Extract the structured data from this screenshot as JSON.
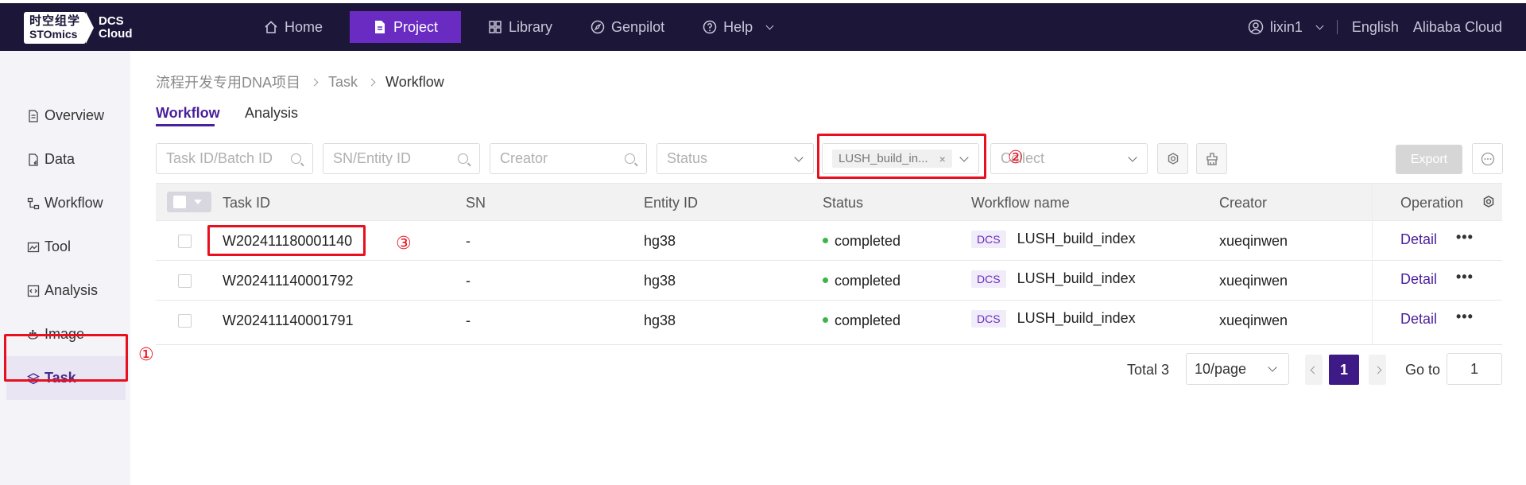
{
  "logo": {
    "cn": "时空组学",
    "en": "STOmics",
    "product_line1": "DCS",
    "product_line2": "Cloud"
  },
  "nav": [
    {
      "label": "Home",
      "icon": "home-icon"
    },
    {
      "label": "Project",
      "icon": "document-icon",
      "active": true
    },
    {
      "label": "Library",
      "icon": "grid-icon"
    },
    {
      "label": "Genpilot",
      "icon": "compass-icon"
    },
    {
      "label": "Help",
      "icon": "help-icon"
    }
  ],
  "user": {
    "name": "lixin1",
    "language": "English",
    "region": "Alibaba Cloud"
  },
  "sidebar": {
    "items": [
      {
        "label": "Overview",
        "icon": "document-icon"
      },
      {
        "label": "Data",
        "icon": "file-icon"
      },
      {
        "label": "Workflow",
        "icon": "workflow-icon"
      },
      {
        "label": "Tool",
        "icon": "toolbox-icon"
      },
      {
        "label": "Analysis",
        "icon": "code-icon"
      },
      {
        "label": "Image",
        "icon": "docker-icon"
      },
      {
        "label": "Task",
        "icon": "layers-icon",
        "active": true
      }
    ]
  },
  "breadcrumb": {
    "project": "流程开发专用DNA项目",
    "section": "Task",
    "current": "Workflow"
  },
  "tabs": {
    "workflow": "Workflow",
    "analysis": "Analysis"
  },
  "filters": {
    "task_id_placeholder": "Task ID/Batch ID",
    "sn_placeholder": "SN/Entity ID",
    "creator_placeholder": "Creator",
    "status_placeholder": "Status",
    "workflow_tag": "LUSH_build_in...",
    "collect_placeholder": "Collect",
    "export_label": "Export"
  },
  "table": {
    "headers": {
      "task_id": "Task ID",
      "sn": "SN",
      "entity_id": "Entity ID",
      "status": "Status",
      "workflow_name": "Workflow name",
      "creator": "Creator",
      "operation": "Operation"
    },
    "rows": [
      {
        "task_id": "W202411180001140",
        "sn": "-",
        "entity_id": "hg38",
        "status": "completed",
        "badge": "DCS",
        "workflow_name": "LUSH_build_index",
        "creator": "xueqinwen",
        "detail": "Detail"
      },
      {
        "task_id": "W202411140001792",
        "sn": "-",
        "entity_id": "hg38",
        "status": "completed",
        "badge": "DCS",
        "workflow_name": "LUSH_build_index",
        "creator": "xueqinwen",
        "detail": "Detail"
      },
      {
        "task_id": "W202411140001791",
        "sn": "-",
        "entity_id": "hg38",
        "status": "completed",
        "badge": "DCS",
        "workflow_name": "LUSH_build_index",
        "creator": "xueqinwen",
        "detail": "Detail"
      }
    ]
  },
  "pagination": {
    "total": "Total 3",
    "page_size": "10/page",
    "current_page": "1",
    "goto_label": "Go to",
    "goto_value": "1"
  },
  "annotations": {
    "one": "①",
    "two": "②",
    "three": "③"
  },
  "colors": {
    "nav_bg": "#1c1638",
    "accent": "#6a2bc2",
    "annotation_red": "#e8101e",
    "status_green": "#3bb54a"
  }
}
